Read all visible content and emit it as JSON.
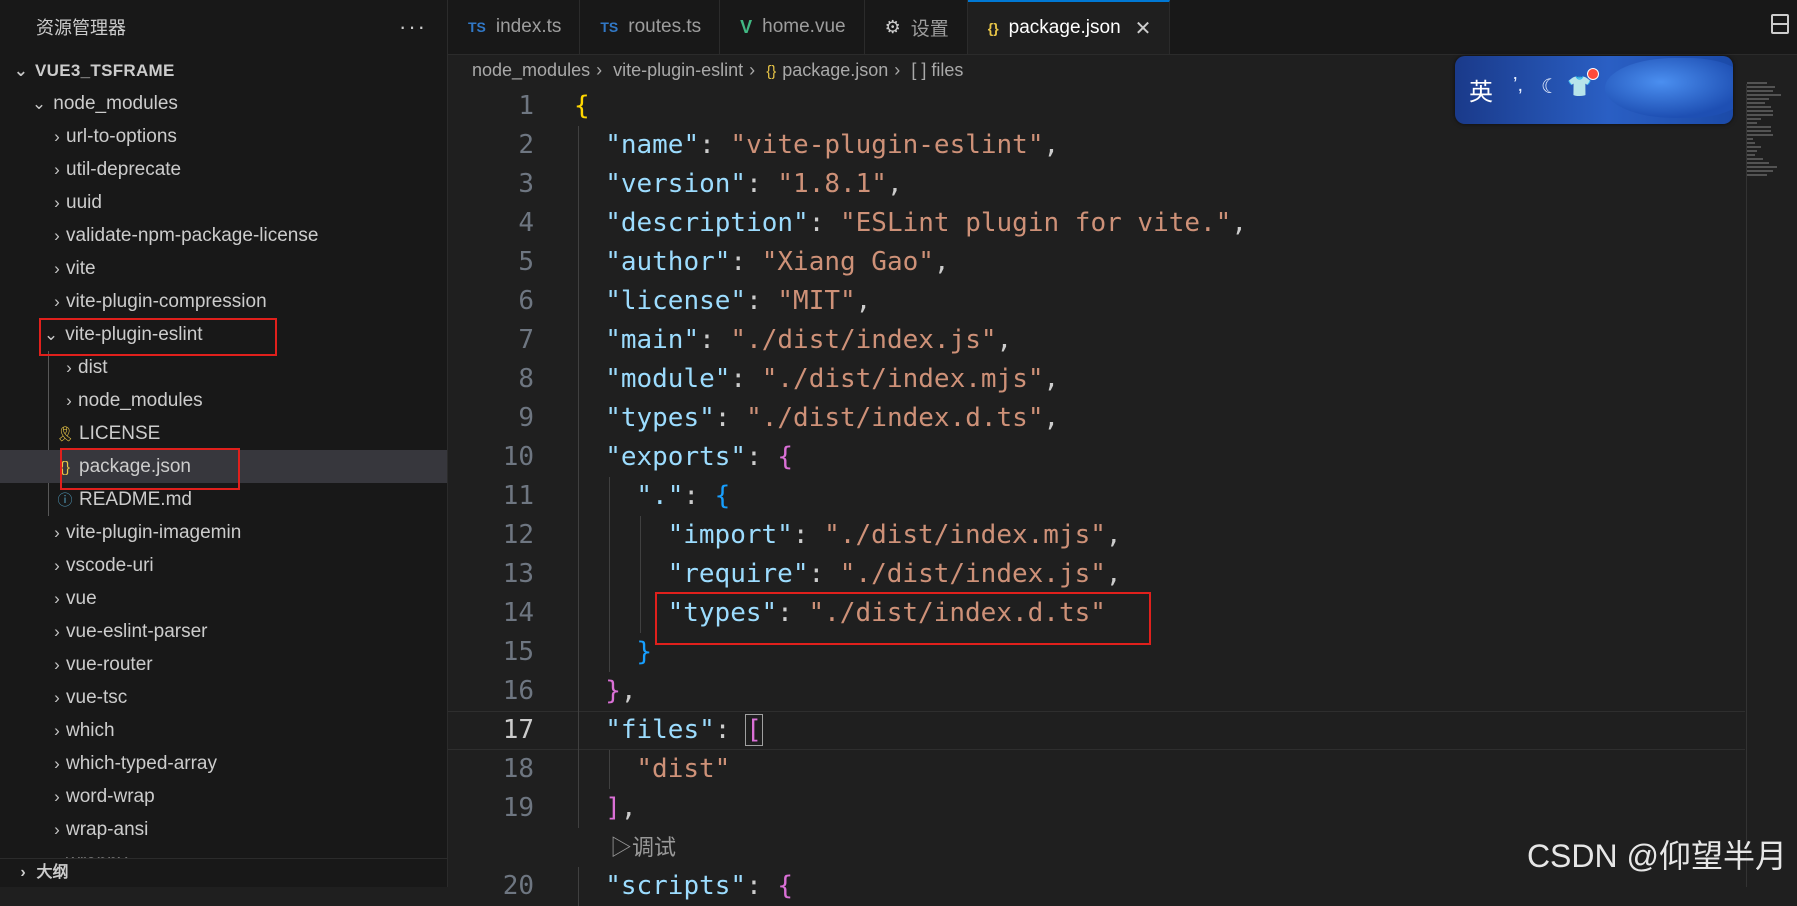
{
  "sidebar": {
    "title": "资源管理器",
    "root": "VUE3_TSFRAME",
    "node_modules": "node_modules",
    "items": [
      "url-to-options",
      "util-deprecate",
      "uuid",
      "validate-npm-package-license",
      "vite",
      "vite-plugin-compression"
    ],
    "eslint_folder": "vite-plugin-eslint",
    "eslint_children": [
      {
        "label": "dist",
        "kind": "folder"
      },
      {
        "label": "node_modules",
        "kind": "folder"
      },
      {
        "label": "LICENSE",
        "kind": "license"
      },
      {
        "label": "package.json",
        "kind": "json"
      },
      {
        "label": "README.md",
        "kind": "info"
      }
    ],
    "items_after": [
      "vite-plugin-imagemin",
      "vscode-uri",
      "vue",
      "vue-eslint-parser",
      "vue-router",
      "vue-tsc",
      "which",
      "which-typed-array",
      "word-wrap",
      "wrap-ansi",
      "wrappy"
    ],
    "outline_label": "大纲"
  },
  "tabs": [
    {
      "icon": "TS",
      "label": "index.ts"
    },
    {
      "icon": "TS",
      "label": "routes.ts"
    },
    {
      "icon": "V",
      "label": "home.vue"
    },
    {
      "icon": "⚙",
      "label": "设置"
    },
    {
      "icon": "{}",
      "label": "package.json"
    }
  ],
  "breadcrumb": {
    "parts": [
      "node_modules",
      "vite-plugin-eslint",
      "package.json",
      "files"
    ],
    "json_icon": "{}",
    "array_icon": "[ ]"
  },
  "editor": {
    "current_line": 17,
    "line_numbers": [
      "1",
      "2",
      "3",
      "4",
      "5",
      "6",
      "7",
      "8",
      "9",
      "10",
      "11",
      "12",
      "13",
      "14",
      "15",
      "16",
      "17",
      "18",
      "19",
      "20"
    ],
    "values": {
      "name_key": "\"name\"",
      "name_val": "\"vite-plugin-eslint\"",
      "version_key": "\"version\"",
      "version_val": "\"1.8.1\"",
      "description_key": "\"description\"",
      "description_val": "\"ESLint plugin for vite.\"",
      "author_key": "\"author\"",
      "author_val": "\"Xiang Gao\"",
      "license_key": "\"license\"",
      "license_val": "\"MIT\"",
      "main_key": "\"main\"",
      "main_val": "\"./dist/index.js\"",
      "module_key": "\"module\"",
      "module_val": "\"./dist/index.mjs\"",
      "types_key": "\"types\"",
      "types_val": "\"./dist/index.d.ts\"",
      "exports_key": "\"exports\"",
      "dot_key": "\".\"",
      "import_key": "\"import\"",
      "import_val": "\"./dist/index.mjs\"",
      "require_key": "\"require\"",
      "require_val": "\"./dist/index.js\"",
      "types2_key": "\"types\"",
      "types2_val": "\"./dist/index.d.ts\"",
      "files_key": "\"files\"",
      "dist_val": "\"dist\"",
      "scripts_key": "\"scripts\""
    },
    "codelens": "▷调试"
  },
  "ime": {
    "lang": "英"
  },
  "watermark": "CSDN @仰望半月",
  "colors": {
    "accent": "#0078d4",
    "highlight_box": "#e0201c"
  }
}
